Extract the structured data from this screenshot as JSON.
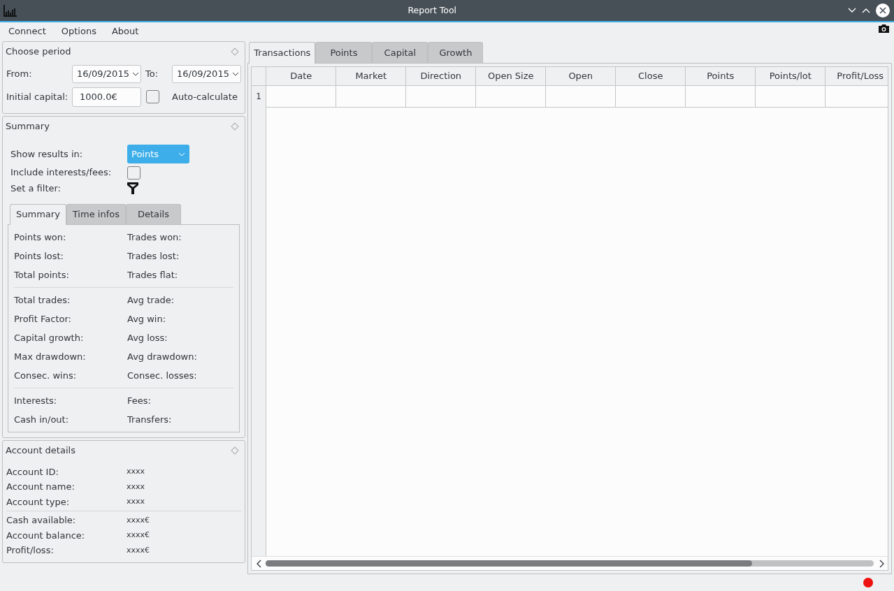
{
  "window": {
    "title": "Report Tool"
  },
  "menu": [
    "Connect",
    "Options",
    "About"
  ],
  "period": {
    "title": "Choose period",
    "from_label": "From:",
    "from_value": "16/09/2015",
    "to_label": "To:",
    "to_value": "16/09/2015",
    "capital_label": "Initial capital:",
    "capital_value": "1000.0€",
    "auto_label": "Auto-calculate",
    "auto_checked": false
  },
  "summary": {
    "title": "Summary",
    "show_label": "Show results in:",
    "show_value": "Points",
    "include_label": "Include interests/fees:",
    "include_checked": false,
    "filter_label": "Set a filter:",
    "tabs": [
      {
        "label": "Summary",
        "selected": true
      },
      {
        "label": "Time infos",
        "selected": false
      },
      {
        "label": "Details",
        "selected": false
      }
    ],
    "groups": [
      [
        {
          "left": "Points won:",
          "right": "Trades won:"
        },
        {
          "left": "Points lost:",
          "right": "Trades lost:"
        },
        {
          "left": "Total points:",
          "right": "Trades flat:"
        }
      ],
      [
        {
          "left": "Total trades:",
          "right": "Avg trade:"
        },
        {
          "left": "Profit Factor:",
          "right": "Avg win:"
        },
        {
          "left": "Capital growth:",
          "right": "Avg loss:"
        },
        {
          "left": "Max drawdown:",
          "right": "Avg drawdown:"
        },
        {
          "left": "Consec. wins:",
          "right": "Consec. losses:"
        }
      ],
      [
        {
          "left": "Interests:",
          "right": "Fees:"
        },
        {
          "left": "Cash in/out:",
          "right": "Transfers:"
        }
      ]
    ]
  },
  "account": {
    "title": "Account details",
    "groups": [
      [
        {
          "label": "Account ID:",
          "value": "xxxx"
        },
        {
          "label": "Account name:",
          "value": "xxxx"
        },
        {
          "label": "Account type:",
          "value": "xxxx"
        }
      ],
      [
        {
          "label": "Cash available:",
          "value": "xxxx€"
        },
        {
          "label": "Account balance:",
          "value": "xxxx€"
        },
        {
          "label": "Profit/loss:",
          "value": "xxxx€"
        }
      ]
    ]
  },
  "main_tabs": [
    {
      "label": "Transactions",
      "selected": true
    },
    {
      "label": "Points",
      "selected": false
    },
    {
      "label": "Capital",
      "selected": false
    },
    {
      "label": "Growth",
      "selected": false
    }
  ],
  "table": {
    "columns": [
      "Date",
      "Market",
      "Direction",
      "Open Size",
      "Open",
      "Close",
      "Points",
      "Points/lot",
      "Profit/Loss"
    ],
    "rows": [
      {
        "number": "1"
      }
    ]
  },
  "status_bar": {
    "color": "#ee1111"
  }
}
